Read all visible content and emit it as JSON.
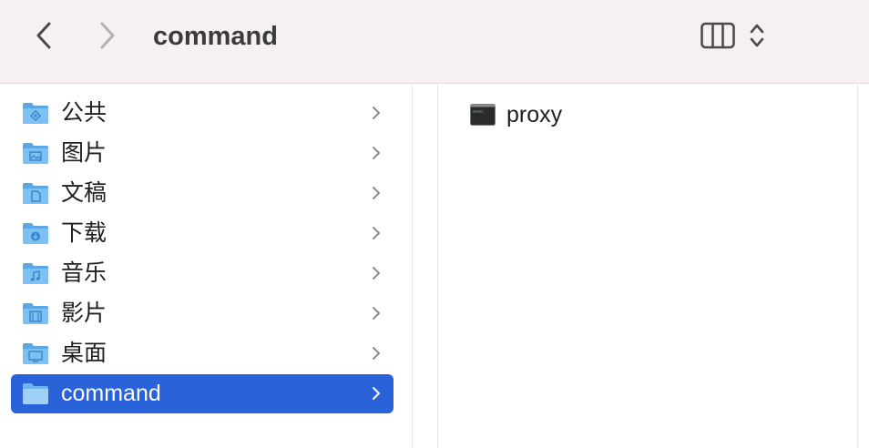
{
  "toolbar": {
    "title": "command",
    "icons": {
      "back": "chevron-left-icon",
      "forward": "chevron-right-icon",
      "view": "columns-view-icon",
      "view_menu": "updown-chevron-icon"
    }
  },
  "sidebar": {
    "items": [
      {
        "label": "公共",
        "icon": "public-folder-icon",
        "selected": false
      },
      {
        "label": "图片",
        "icon": "pictures-folder-icon",
        "selected": false
      },
      {
        "label": "文稿",
        "icon": "documents-folder-icon",
        "selected": false
      },
      {
        "label": "下载",
        "icon": "downloads-folder-icon",
        "selected": false
      },
      {
        "label": "音乐",
        "icon": "music-folder-icon",
        "selected": false
      },
      {
        "label": "影片",
        "icon": "movies-folder-icon",
        "selected": false
      },
      {
        "label": "桌面",
        "icon": "desktop-folder-icon",
        "selected": false
      },
      {
        "label": "command",
        "icon": "folder-icon",
        "selected": true
      }
    ]
  },
  "content": {
    "files": [
      {
        "name": "proxy",
        "icon": "terminal-executable-icon"
      }
    ]
  },
  "colors": {
    "toolbar_bg": "#f7f0f0",
    "selection": "#2962d9",
    "folder_blue": "#6fb5ec"
  }
}
